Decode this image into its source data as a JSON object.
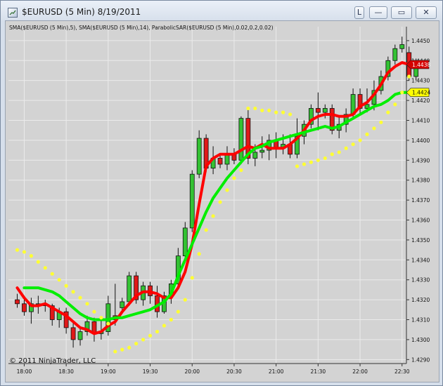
{
  "window": {
    "title": "$EURUSD (5 Min)  8/19/2011",
    "buttons": {
      "layout": "L",
      "minimize": "—",
      "maximize": "▭",
      "close": "✕"
    }
  },
  "indicators_label": "SMA($EURUSD  (5 Min),5),  SMA($EURUSD  (5 Min),14),  ParabolicSAR($EURUSD  (5 Min),0.02,0.2,0.02)",
  "copyright": "© 2011 NinjaTrader, LLC",
  "colors": {
    "background": "#d3d3d3",
    "grid": "#ebebeb",
    "up_candle": "#33c233",
    "down_candle": "#e01919",
    "sma5": "#ff0000",
    "sma14": "#00ee00",
    "sar": "#ffff33",
    "last_price_box": "#d40000",
    "sma14_price_box": "#ffff00"
  },
  "chart_data": {
    "type": "candlestick",
    "x_ticks": [
      "18:00",
      "18:30",
      "19:00",
      "19:30",
      "20:00",
      "20:30",
      "21:00",
      "21:30",
      "22:00",
      "22:30"
    ],
    "x_tick_bars": [
      1,
      7,
      13,
      19,
      25,
      31,
      37,
      43,
      49,
      55
    ],
    "y_ticks": [
      "1.4290",
      "1.4300",
      "1.4310",
      "1.4320",
      "1.4330",
      "1.4340",
      "1.4350",
      "1.4360",
      "1.4370",
      "1.4380",
      "1.4390",
      "1.4400",
      "1.4410",
      "1.4420",
      "1.4430",
      "1.4440",
      "1.4450"
    ],
    "ylim": [
      1.4288,
      1.4457
    ],
    "grid": true,
    "last_price_label": "1.4438",
    "sma14_last_label": "1.4424",
    "candles": [
      {
        "o": 1.432,
        "h": 1.4323,
        "l": 1.4316,
        "c": 1.4318
      },
      {
        "o": 1.4318,
        "h": 1.4322,
        "l": 1.4312,
        "c": 1.4314
      },
      {
        "o": 1.4314,
        "h": 1.4321,
        "l": 1.4308,
        "c": 1.4318
      },
      {
        "o": 1.4318,
        "h": 1.4322,
        "l": 1.4313,
        "c": 1.4318
      },
      {
        "o": 1.4318,
        "h": 1.432,
        "l": 1.4314,
        "c": 1.4317
      },
      {
        "o": 1.4317,
        "h": 1.4318,
        "l": 1.4307,
        "c": 1.431
      },
      {
        "o": 1.431,
        "h": 1.4316,
        "l": 1.4306,
        "c": 1.4314
      },
      {
        "o": 1.4314,
        "h": 1.4316,
        "l": 1.4303,
        "c": 1.4306
      },
      {
        "o": 1.4306,
        "h": 1.4309,
        "l": 1.4296,
        "c": 1.43
      },
      {
        "o": 1.43,
        "h": 1.4306,
        "l": 1.4297,
        "c": 1.4304
      },
      {
        "o": 1.4304,
        "h": 1.4312,
        "l": 1.4302,
        "c": 1.4309
      },
      {
        "o": 1.4309,
        "h": 1.4311,
        "l": 1.4299,
        "c": 1.4303
      },
      {
        "o": 1.4303,
        "h": 1.431,
        "l": 1.43,
        "c": 1.4304
      },
      {
        "o": 1.4304,
        "h": 1.4322,
        "l": 1.4302,
        "c": 1.4318
      },
      {
        "o": 1.4312,
        "h": 1.4328,
        "l": 1.4307,
        "c": 1.431
      },
      {
        "o": 1.4316,
        "h": 1.4321,
        "l": 1.4313,
        "c": 1.4319
      },
      {
        "o": 1.4319,
        "h": 1.4334,
        "l": 1.4317,
        "c": 1.4332
      },
      {
        "o": 1.4332,
        "h": 1.4334,
        "l": 1.4318,
        "c": 1.432
      },
      {
        "o": 1.432,
        "h": 1.4329,
        "l": 1.4317,
        "c": 1.4327
      },
      {
        "o": 1.4327,
        "h": 1.4329,
        "l": 1.4318,
        "c": 1.4322
      },
      {
        "o": 1.4322,
        "h": 1.4327,
        "l": 1.4311,
        "c": 1.4314
      },
      {
        "o": 1.4314,
        "h": 1.4324,
        "l": 1.4313,
        "c": 1.4322
      },
      {
        "o": 1.4322,
        "h": 1.433,
        "l": 1.4318,
        "c": 1.4328
      },
      {
        "o": 1.4328,
        "h": 1.4346,
        "l": 1.4325,
        "c": 1.4342
      },
      {
        "o": 1.4342,
        "h": 1.4359,
        "l": 1.4339,
        "c": 1.4356
      },
      {
        "o": 1.4356,
        "h": 1.4385,
        "l": 1.4354,
        "c": 1.4383
      },
      {
        "o": 1.4383,
        "h": 1.4405,
        "l": 1.4381,
        "c": 1.4401
      },
      {
        "o": 1.4401,
        "h": 1.4403,
        "l": 1.4384,
        "c": 1.4386
      },
      {
        "o": 1.4386,
        "h": 1.4397,
        "l": 1.4383,
        "c": 1.4391
      },
      {
        "o": 1.4391,
        "h": 1.4393,
        "l": 1.4386,
        "c": 1.4388
      },
      {
        "o": 1.4388,
        "h": 1.4397,
        "l": 1.4385,
        "c": 1.4393
      },
      {
        "o": 1.4393,
        "h": 1.4396,
        "l": 1.4388,
        "c": 1.439
      },
      {
        "o": 1.439,
        "h": 1.4412,
        "l": 1.4388,
        "c": 1.4411
      },
      {
        "o": 1.4411,
        "h": 1.4416,
        "l": 1.4388,
        "c": 1.4391
      },
      {
        "o": 1.4391,
        "h": 1.4398,
        "l": 1.4387,
        "c": 1.4394
      },
      {
        "o": 1.4394,
        "h": 1.4402,
        "l": 1.4391,
        "c": 1.4395
      },
      {
        "o": 1.4395,
        "h": 1.4403,
        "l": 1.439,
        "c": 1.44
      },
      {
        "o": 1.44,
        "h": 1.4404,
        "l": 1.4391,
        "c": 1.4396
      },
      {
        "o": 1.4396,
        "h": 1.4403,
        "l": 1.4393,
        "c": 1.4398
      },
      {
        "o": 1.4398,
        "h": 1.4403,
        "l": 1.4391,
        "c": 1.4393
      },
      {
        "o": 1.4393,
        "h": 1.4411,
        "l": 1.4391,
        "c": 1.4402
      },
      {
        "o": 1.4402,
        "h": 1.441,
        "l": 1.4398,
        "c": 1.4408
      },
      {
        "o": 1.4408,
        "h": 1.4418,
        "l": 1.4406,
        "c": 1.4416
      },
      {
        "o": 1.4416,
        "h": 1.4424,
        "l": 1.4405,
        "c": 1.4414
      },
      {
        "o": 1.4414,
        "h": 1.4418,
        "l": 1.4411,
        "c": 1.4416
      },
      {
        "o": 1.4416,
        "h": 1.4418,
        "l": 1.4403,
        "c": 1.4405
      },
      {
        "o": 1.4405,
        "h": 1.4412,
        "l": 1.4401,
        "c": 1.4408
      },
      {
        "o": 1.4408,
        "h": 1.4416,
        "l": 1.4404,
        "c": 1.4413
      },
      {
        "o": 1.4413,
        "h": 1.4426,
        "l": 1.4411,
        "c": 1.4423
      },
      {
        "o": 1.4423,
        "h": 1.4426,
        "l": 1.4413,
        "c": 1.4416
      },
      {
        "o": 1.4416,
        "h": 1.4426,
        "l": 1.4414,
        "c": 1.4418
      },
      {
        "o": 1.4418,
        "h": 1.443,
        "l": 1.4415,
        "c": 1.4425
      },
      {
        "o": 1.4425,
        "h": 1.4435,
        "l": 1.4423,
        "c": 1.4432
      },
      {
        "o": 1.4432,
        "h": 1.4442,
        "l": 1.443,
        "c": 1.444
      },
      {
        "o": 1.444,
        "h": 1.4448,
        "l": 1.4438,
        "c": 1.4446
      },
      {
        "o": 1.4446,
        "h": 1.4452,
        "l": 1.4444,
        "c": 1.4448
      },
      {
        "o": 1.4444,
        "h": 1.4447,
        "l": 1.443,
        "c": 1.4432
      },
      {
        "o": 1.4432,
        "h": 1.4441,
        "l": 1.443,
        "c": 1.4438
      }
    ],
    "series": [
      {
        "name": "SMA($EURUSD  (5 Min),5)",
        "color": "#ff0000",
        "values": [
          1.4326,
          1.4321,
          1.4317,
          1.4317,
          1.4318,
          1.4316,
          1.4314,
          1.4312,
          1.4309,
          1.4306,
          1.4305,
          1.4303,
          1.4304,
          1.4307,
          1.4309,
          1.4314,
          1.4318,
          1.4322,
          1.4324,
          1.4324,
          1.4323,
          1.4321,
          1.4321,
          1.4326,
          1.4334,
          1.4348,
          1.4368,
          1.4387,
          1.4391,
          1.4393,
          1.4393,
          1.4393,
          1.4395,
          1.4397,
          1.4396,
          1.4398,
          1.4396,
          1.4396,
          1.4396,
          1.4398,
          1.4401,
          1.4405,
          1.441,
          1.4412,
          1.4413,
          1.4413,
          1.4412,
          1.4412,
          1.4413,
          1.4417,
          1.4419,
          1.4423,
          1.4428,
          1.4434,
          1.4437,
          1.4439,
          1.4438
        ]
      },
      {
        "name": "SMA($EURUSD  (5 Min),14)",
        "color": "#00ee00",
        "values": [
          null,
          1.4326,
          1.4326,
          1.4326,
          1.4325,
          1.4324,
          1.4322,
          1.4319,
          1.4316,
          1.4313,
          1.4311,
          1.431,
          1.431,
          1.431,
          1.4311,
          1.4311,
          1.4312,
          1.4313,
          1.4314,
          1.4315,
          1.4317,
          1.4319,
          1.4323,
          1.4332,
          1.434,
          1.4348,
          1.4356,
          1.4364,
          1.4371,
          1.4376,
          1.4381,
          1.4385,
          1.4389,
          1.4393,
          1.4396,
          1.4397,
          1.4399,
          1.44,
          1.4401,
          1.4402,
          1.4403,
          1.4404,
          1.4405,
          1.4406,
          1.4407,
          1.4406,
          1.4407,
          1.4409,
          1.4411,
          1.4413,
          1.4415,
          1.4417,
          1.4418,
          1.442,
          1.4423,
          1.4424,
          1.4424
        ]
      },
      {
        "name": "ParabolicSAR($EURUSD  (5 Min),0.02,0.2,0.02)",
        "color": "#ffff33",
        "values": [
          1.4345,
          1.4344,
          1.4342,
          1.4339,
          1.4336,
          1.4333,
          1.433,
          1.4327,
          1.4324,
          1.4321,
          1.4318,
          1.4314,
          1.4311,
          1.4308,
          1.4294,
          1.4295,
          1.4296,
          1.4298,
          1.43,
          1.4302,
          1.4304,
          1.4307,
          1.431,
          1.4314,
          1.432,
          1.4331,
          1.4343,
          1.4355,
          1.4362,
          1.4369,
          1.4375,
          1.4381,
          1.4385,
          1.4416,
          1.4416,
          1.4415,
          1.4415,
          1.4414,
          1.4414,
          1.4413,
          1.4387,
          1.4388,
          1.4389,
          1.439,
          1.4391,
          1.4393,
          1.4394,
          1.4396,
          1.4398,
          1.44,
          1.4403,
          1.4406,
          1.4409,
          1.4414,
          1.4418,
          1.4424,
          1.4432
        ]
      }
    ]
  }
}
